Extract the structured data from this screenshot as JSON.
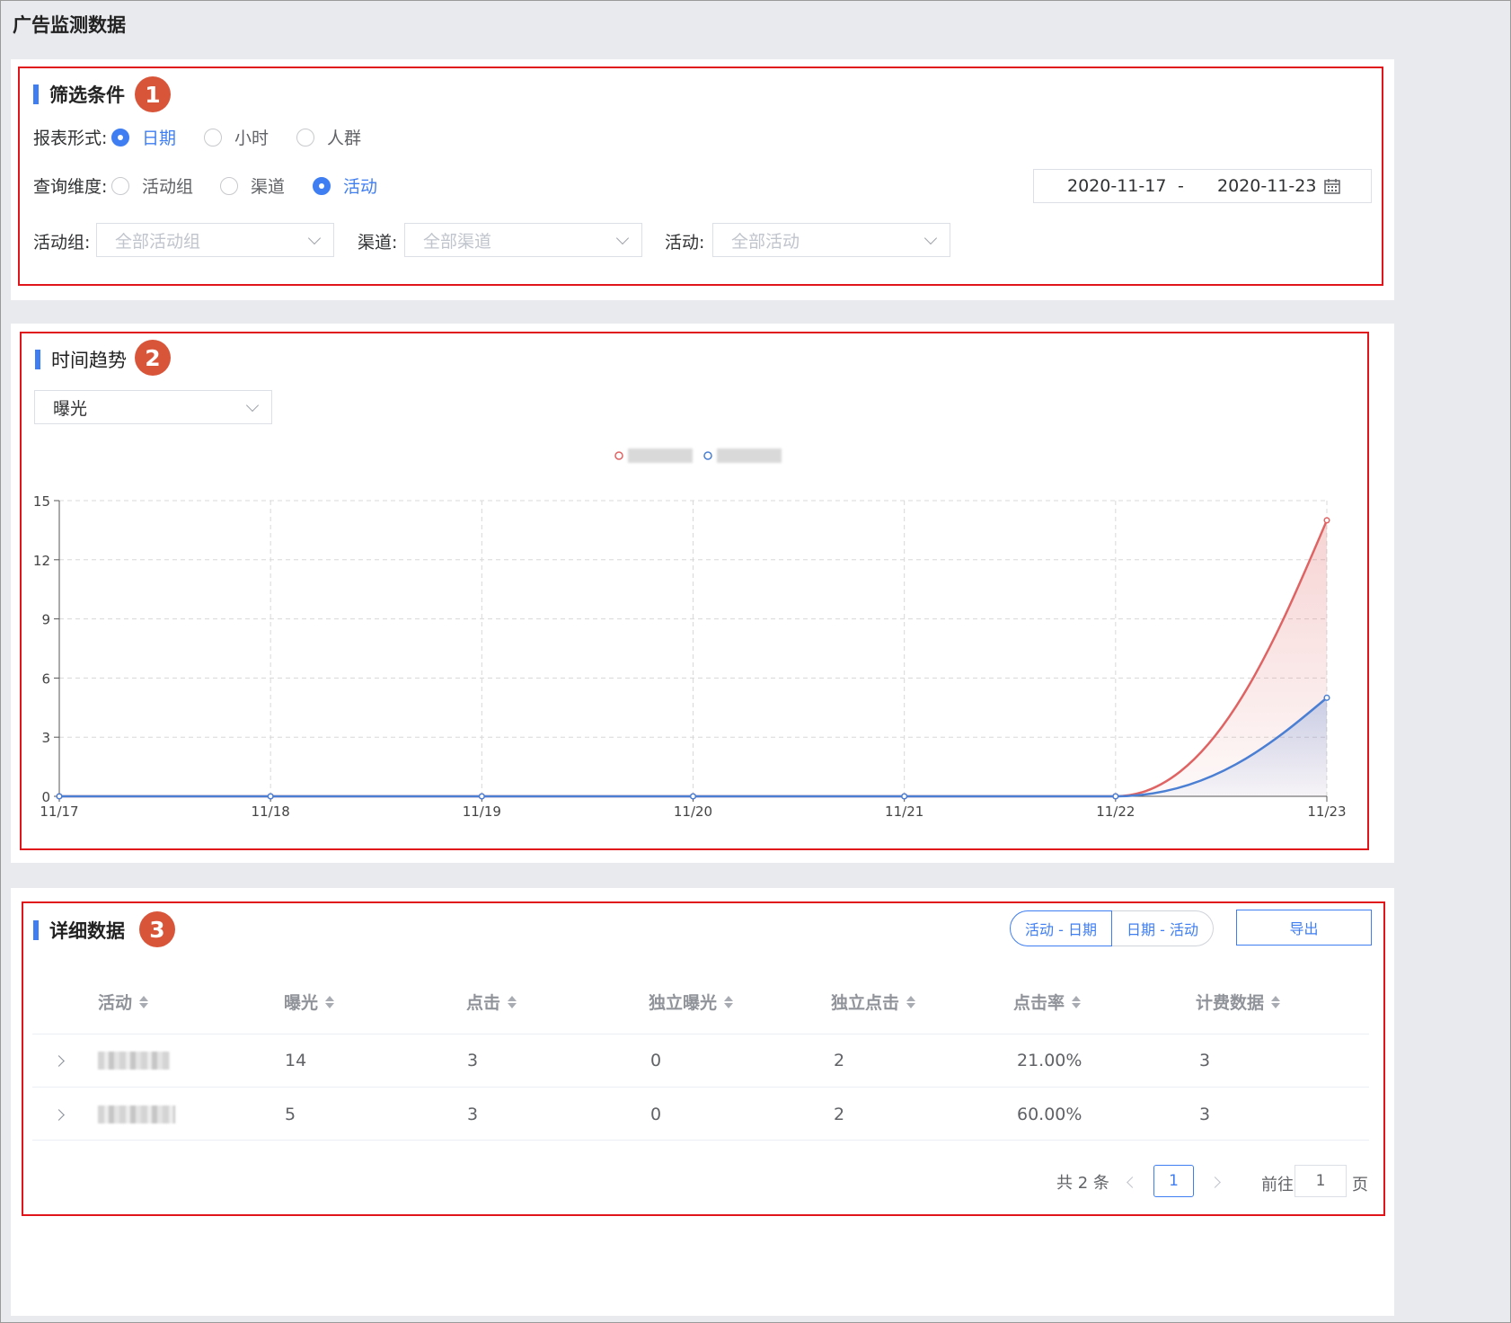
{
  "page": {
    "title": "广告监测数据"
  },
  "filters": {
    "title": "筛选条件",
    "badge": "1",
    "report_form_label": "报表形式:",
    "report_options": [
      {
        "label": "日期",
        "checked": true
      },
      {
        "label": "小时",
        "checked": false
      },
      {
        "label": "人群",
        "checked": false
      }
    ],
    "dimension_label": "查询维度:",
    "dimension_options": [
      {
        "label": "活动组",
        "checked": false
      },
      {
        "label": "渠道",
        "checked": false
      },
      {
        "label": "活动",
        "checked": true
      }
    ],
    "date_start": "2020-11-17",
    "date_separator": "-",
    "date_end": "2020-11-23",
    "group_label": "活动组:",
    "group_placeholder": "全部活动组",
    "channel_label": "渠道:",
    "channel_placeholder": "全部渠道",
    "activity_label": "活动:",
    "activity_placeholder": "全部活动"
  },
  "trend": {
    "title": "时间趋势",
    "badge": "2",
    "metric_selected": "曝光"
  },
  "chart_data": {
    "type": "area",
    "categories": [
      "11/17",
      "11/18",
      "11/19",
      "11/20",
      "11/21",
      "11/22",
      "11/23"
    ],
    "ylim": [
      0,
      15
    ],
    "yticks": [
      0,
      3,
      6,
      9,
      12,
      15
    ],
    "grid": true,
    "legend_position": "top-center",
    "series": [
      {
        "values": [
          0,
          0,
          0,
          0,
          0,
          0,
          14
        ],
        "color": "#e06363"
      },
      {
        "values": [
          0,
          0,
          0,
          0,
          0,
          0,
          5
        ],
        "color": "#4a7fd3"
      }
    ]
  },
  "details": {
    "title": "详细数据",
    "badge": "3",
    "view_activity_date": "活动 - 日期",
    "view_date_activity": "日期 - 活动",
    "export_label": "导出",
    "columns": [
      "活动",
      "曝光",
      "点击",
      "独立曝光",
      "独立点击",
      "点击率",
      "计费数据"
    ],
    "rows": [
      {
        "exposure": "14",
        "clicks": "3",
        "unique_exposure": "0",
        "unique_clicks": "2",
        "ctr": "21.00%",
        "billing": "3"
      },
      {
        "exposure": "5",
        "clicks": "3",
        "unique_exposure": "0",
        "unique_clicks": "2",
        "ctr": "60.00%",
        "billing": "3"
      }
    ],
    "pagination": {
      "total_text": "共 2 条",
      "current_page": "1",
      "goto_label": "前往",
      "goto_value": "1",
      "page_suffix": "页"
    }
  },
  "colors": {
    "accent": "#3f7ef2",
    "annotation": "#e0151c",
    "badge": "#d9553a"
  },
  "icons": {
    "calendar": "calendar-icon",
    "dropdown": "chevron-down-icon",
    "sort": "sort-icon",
    "expand": "chevron-right-icon"
  }
}
